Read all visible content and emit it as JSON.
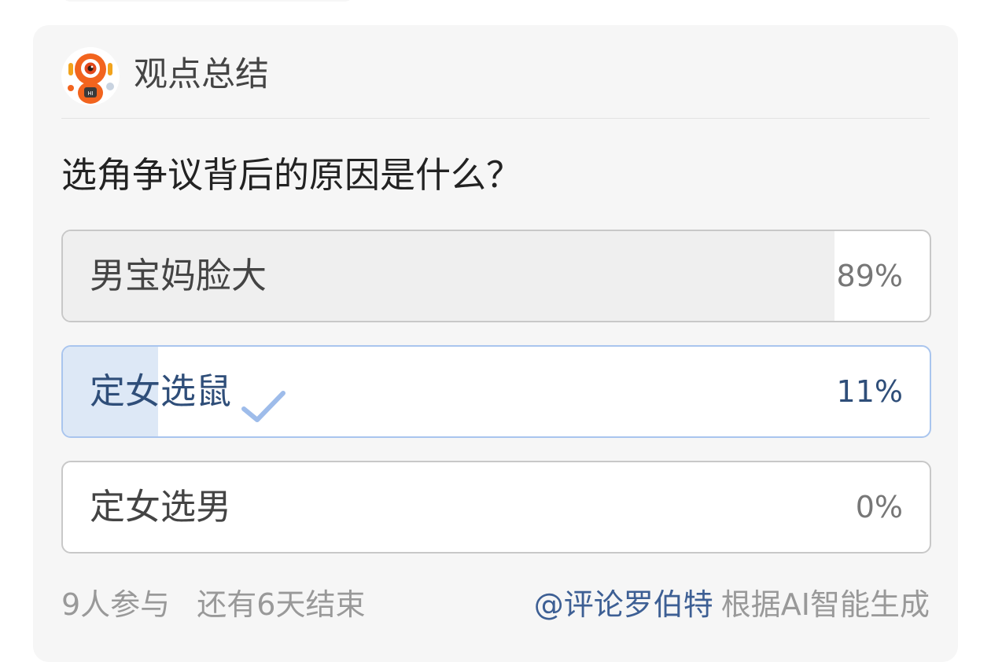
{
  "header": {
    "title": "观点总结",
    "avatar_icon": "robot-mascot-icon"
  },
  "poll": {
    "question": "选角争议背后的原因是什么？",
    "options": [
      {
        "label": "男宝妈脸大",
        "percent_label": "89%",
        "percent": 89,
        "selected": false
      },
      {
        "label": "定女选鼠",
        "percent_label": "11%",
        "percent": 11,
        "selected": true
      },
      {
        "label": "定女选男",
        "percent_label": "0%",
        "percent": 0,
        "selected": false
      }
    ],
    "check_icon": "check-icon"
  },
  "footer": {
    "participants": "9人参与",
    "time_left": "还有6天结束",
    "mention": "@评论罗伯特",
    "ai_note": "根据AI智能生成"
  },
  "colors": {
    "card_bg": "#f6f6f6",
    "fill_default": "#efefef",
    "fill_selected": "#dde8f6",
    "border_selected": "#a9c5ee",
    "accent_text": "#2f4e79",
    "mention": "#3d5f94",
    "mascot_orange": "#f2641e"
  }
}
